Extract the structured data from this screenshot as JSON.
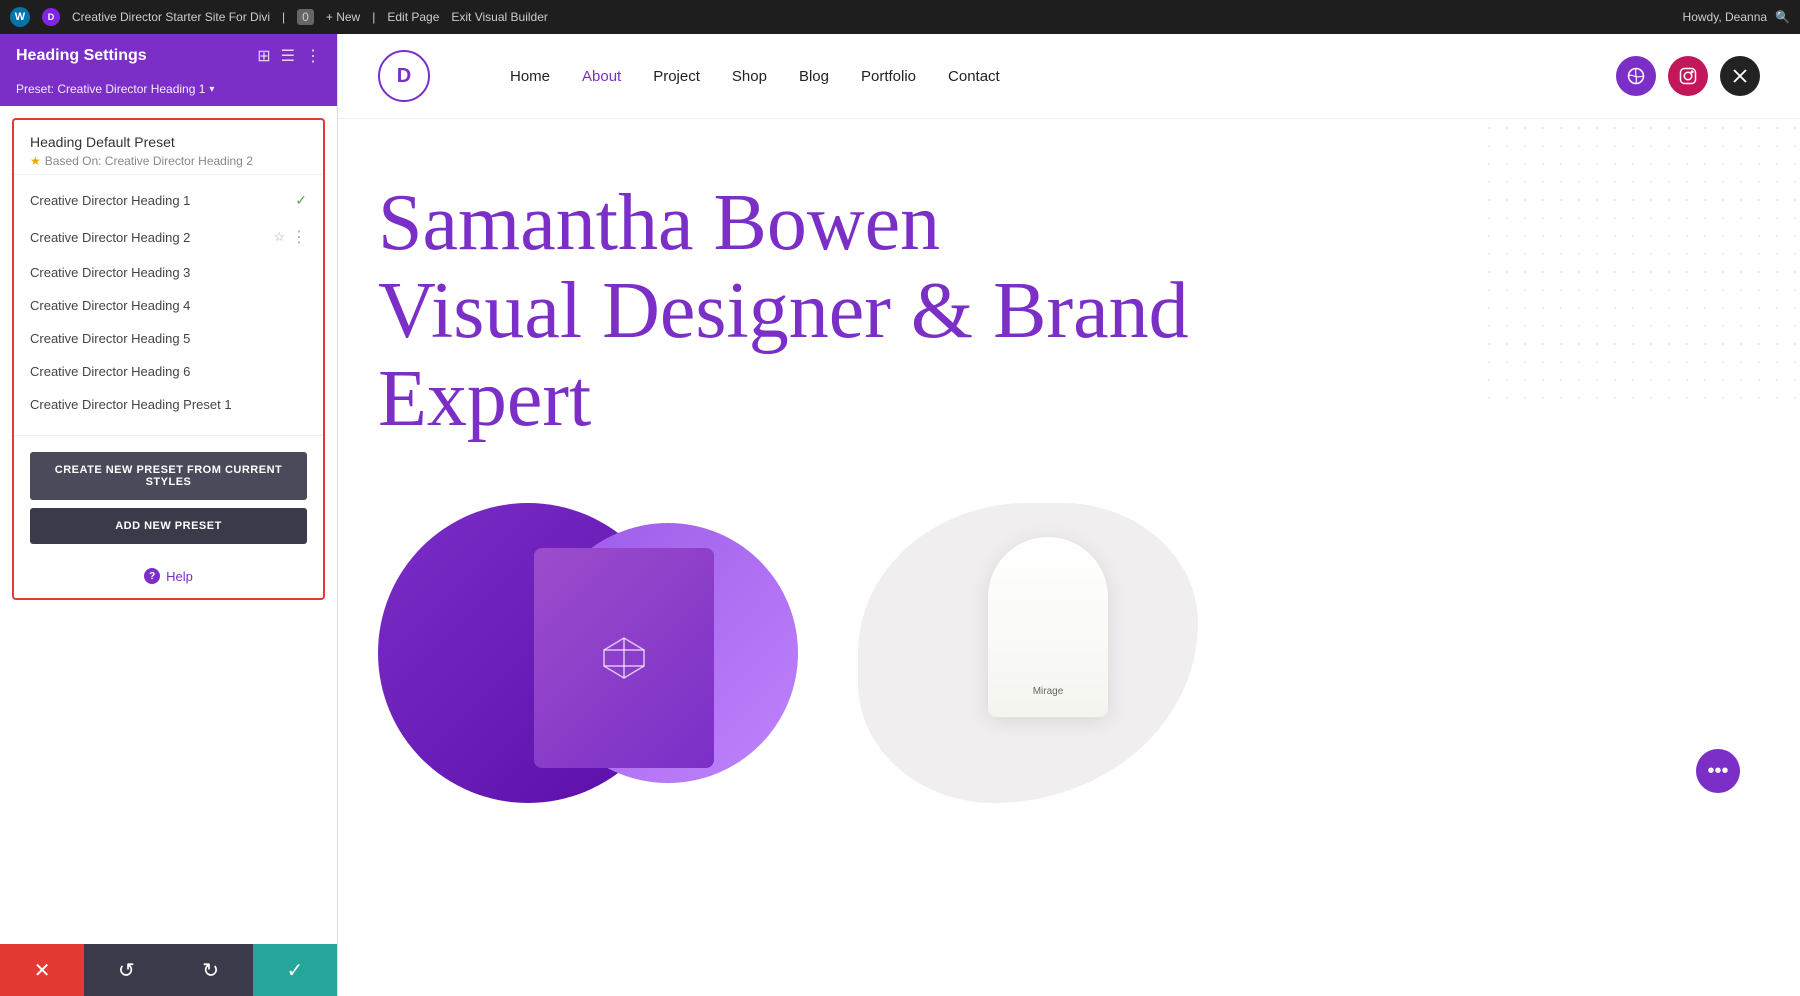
{
  "admin_bar": {
    "wp_logo": "W",
    "site_name": "Creative Director Starter Site For Divi",
    "comment_count": "0",
    "new_label": "+ New",
    "edit_page_label": "Edit Page",
    "exit_builder_label": "Exit Visual Builder",
    "howdy": "Howdy, Deanna"
  },
  "sidebar": {
    "title": "Heading Settings",
    "preset_label": "Preset: Creative Director Heading 1",
    "header_icons": [
      "resize",
      "columns",
      "ellipsis"
    ],
    "presets_panel": {
      "header": {
        "name": "Heading Default Preset",
        "based_on": "Based On: Creative Director Heading 2"
      },
      "items": [
        {
          "label": "Creative Director Heading 1",
          "active": true,
          "starred": false
        },
        {
          "label": "Creative Director Heading 2",
          "active": false,
          "starred": true
        },
        {
          "label": "Creative Director Heading 3",
          "active": false,
          "starred": false
        },
        {
          "label": "Creative Director Heading 4",
          "active": false,
          "starred": false
        },
        {
          "label": "Creative Director Heading 5",
          "active": false,
          "starred": false
        },
        {
          "label": "Creative Director Heading 6",
          "active": false,
          "starred": false
        },
        {
          "label": "Creative Director Heading Preset 1",
          "active": false,
          "starred": false
        }
      ],
      "create_btn": "CREATE NEW PRESET FROM CURRENT STYLES",
      "add_btn": "ADD NEW PRESET",
      "help_label": "Help"
    }
  },
  "toolbar": {
    "cancel_icon": "✕",
    "undo_icon": "↺",
    "redo_icon": "↻",
    "save_icon": "✓"
  },
  "site": {
    "logo": "D",
    "nav_links": [
      "Home",
      "About",
      "Project",
      "Shop",
      "Blog",
      "Portfolio",
      "Contact"
    ],
    "social": [
      "dribbble",
      "instagram",
      "twitter-x"
    ]
  },
  "hero": {
    "title_line1": "Samantha Bowen",
    "title_line2": "Visual Designer & Brand",
    "title_line3": "Expert"
  },
  "products": {
    "candle_name": "Mirage",
    "fab_icon": "•••"
  }
}
